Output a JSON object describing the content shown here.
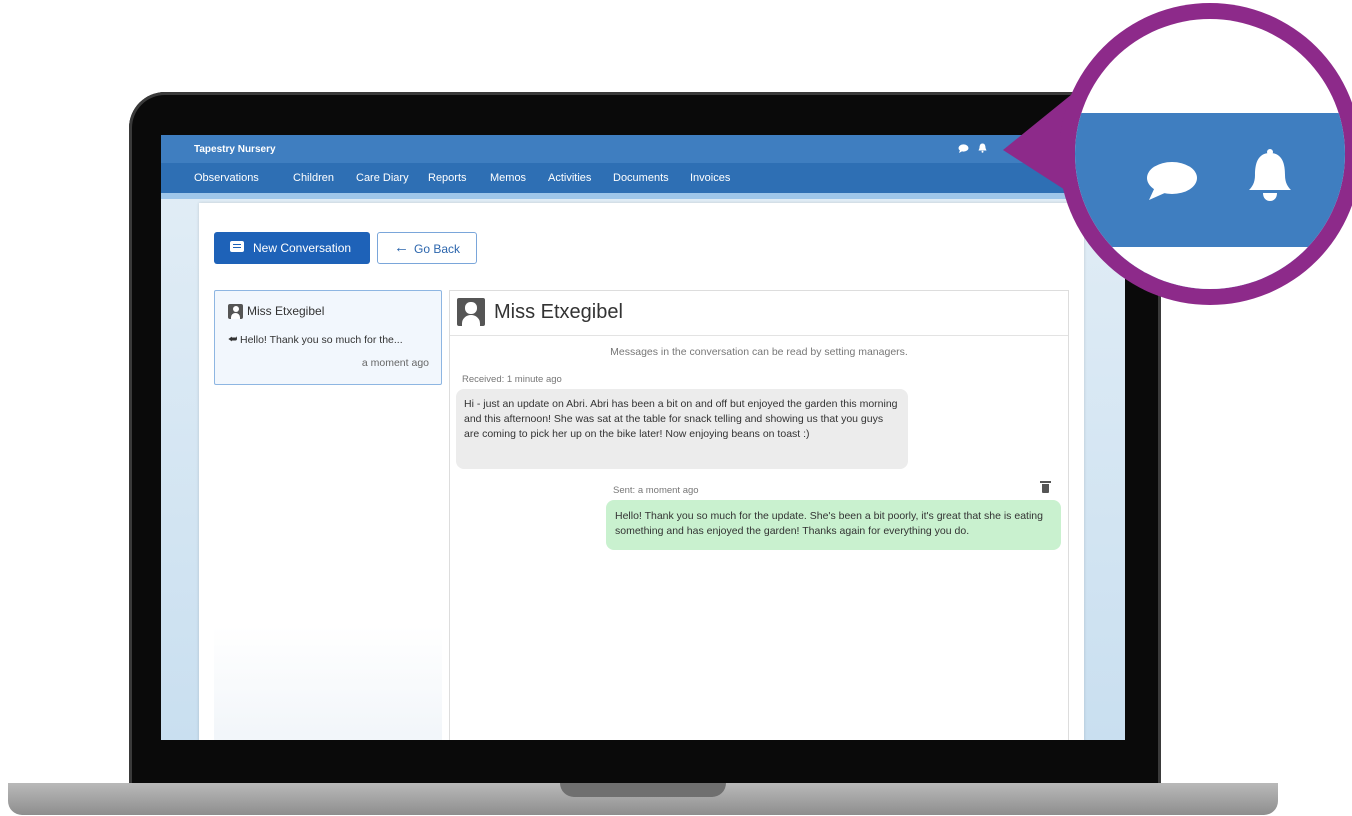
{
  "app": {
    "title": "Tapestry Nursery"
  },
  "nav": {
    "items": [
      "Observations",
      "Children",
      "Care Diary",
      "Reports",
      "Memos",
      "Activities",
      "Documents",
      "Invoices"
    ]
  },
  "toolbar": {
    "new_conversation_label": "New Conversation",
    "go_back_label": "Go Back"
  },
  "conversation_list": {
    "items": [
      {
        "name": "Miss Etxegibel",
        "preview": "Hello! Thank you so much for the...",
        "time": "a moment ago"
      }
    ]
  },
  "chat": {
    "title": "Miss Etxegibel",
    "notice": "Messages in the conversation can be read by setting managers.",
    "messages": [
      {
        "direction": "received",
        "label": "Received: 1 minute ago",
        "text": "Hi - just an update on Abri. Abri has been a bit on and off but enjoyed the garden this morning and this afternoon! She was sat at the table for snack telling and showing us that you guys are coming to pick her up on the bike later! Now enjoying beans on toast :)"
      },
      {
        "direction": "sent",
        "label": "Sent: a moment ago",
        "text": "Hello! Thank you so much for the update. She's been a bit poorly, it's great that she is eating something and has enjoyed the garden! Thanks again for everything you do."
      }
    ]
  },
  "icons": {
    "messages": "chat-bubble-icon",
    "notifications": "bell-icon",
    "delete": "trash-icon",
    "reply": "reply-icon"
  },
  "colors": {
    "header_blue": "#3f7ec0",
    "primary_button": "#1e62b8",
    "callout_purple": "#8d2a8a",
    "sent_bubble": "#c9f1cf",
    "received_bubble": "#ececec"
  }
}
